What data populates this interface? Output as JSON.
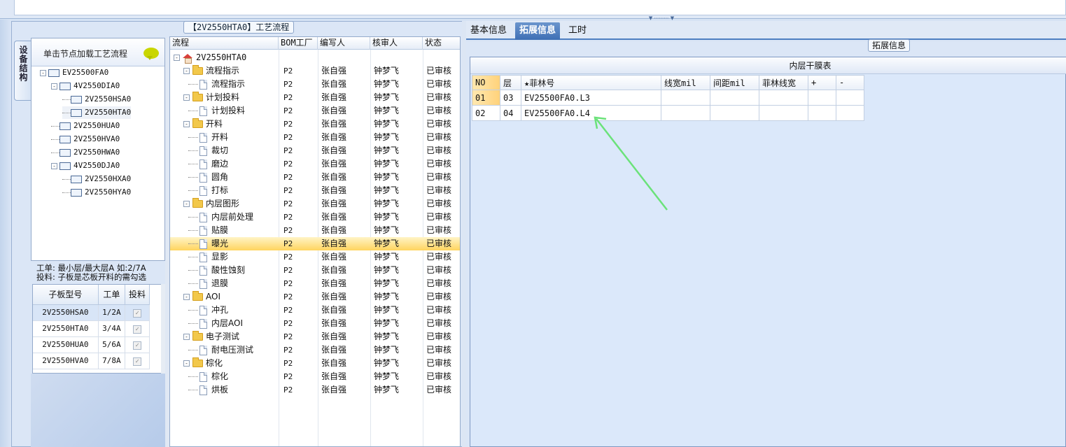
{
  "left": {
    "panel_title": "【2V2550HTA0】工艺流程",
    "vertical_tab": "设备结构",
    "tree_header": "单击节点加载工艺流程",
    "tree": [
      {
        "label": "EV25500FA0",
        "level": 0,
        "expander": "-"
      },
      {
        "label": "4V2550DIA0",
        "level": 1,
        "expander": "-"
      },
      {
        "label": "2V2550HSA0",
        "level": 2,
        "expander": ""
      },
      {
        "label": "2V2550HTA0",
        "level": 2,
        "expander": "",
        "selected": true
      },
      {
        "label": "2V2550HUA0",
        "level": 1,
        "expander": ""
      },
      {
        "label": "2V2550HVA0",
        "level": 1,
        "expander": ""
      },
      {
        "label": "2V2550HWA0",
        "level": 1,
        "expander": ""
      },
      {
        "label": "4V2550DJA0",
        "level": 1,
        "expander": "-"
      },
      {
        "label": "2V2550HXA0",
        "level": 2,
        "expander": ""
      },
      {
        "label": "2V2550HYA0",
        "level": 2,
        "expander": ""
      }
    ],
    "note_line1": "工单: 最小层/最大层A 如:2/7A",
    "note_line2": "投料: 子板是芯板开料的需勾选",
    "sub_grid": {
      "headers": [
        "子板型号",
        "工单",
        "投料"
      ],
      "rows": [
        {
          "model": "2V2550HSA0",
          "order": "1/2A",
          "checked": true
        },
        {
          "model": "2V2550HTA0",
          "order": "3/4A",
          "checked": true
        },
        {
          "model": "2V2550HUA0",
          "order": "5/6A",
          "checked": true
        },
        {
          "model": "2V2550HVA0",
          "order": "7/8A",
          "checked": true
        }
      ],
      "check_mark": "✓"
    }
  },
  "flow": {
    "headers": [
      "流程",
      "BOM工厂",
      "编写人",
      "核审人",
      "状态"
    ],
    "rows": [
      {
        "name": "2V2550HTA0",
        "type": "root",
        "expander": "-",
        "factory": "",
        "writer": "",
        "reviewer": "",
        "status": ""
      },
      {
        "name": "流程指示",
        "type": "folder",
        "expander": "-",
        "factory": "P2",
        "writer": "张自强",
        "reviewer": "钟梦飞",
        "status": "已审核"
      },
      {
        "name": "流程指示",
        "type": "doc",
        "factory": "P2",
        "writer": "张自强",
        "reviewer": "钟梦飞",
        "status": "已审核"
      },
      {
        "name": "计划投料",
        "type": "folder",
        "expander": "-",
        "factory": "P2",
        "writer": "张自强",
        "reviewer": "钟梦飞",
        "status": "已审核"
      },
      {
        "name": "计划投料",
        "type": "doc",
        "factory": "P2",
        "writer": "张自强",
        "reviewer": "钟梦飞",
        "status": "已审核"
      },
      {
        "name": "开料",
        "type": "folder",
        "expander": "-",
        "factory": "P2",
        "writer": "张自强",
        "reviewer": "钟梦飞",
        "status": "已审核"
      },
      {
        "name": "开料",
        "type": "doc",
        "factory": "P2",
        "writer": "张自强",
        "reviewer": "钟梦飞",
        "status": "已审核"
      },
      {
        "name": "裁切",
        "type": "doc",
        "factory": "P2",
        "writer": "张自强",
        "reviewer": "钟梦飞",
        "status": "已审核"
      },
      {
        "name": "磨边",
        "type": "doc",
        "factory": "P2",
        "writer": "张自强",
        "reviewer": "钟梦飞",
        "status": "已审核"
      },
      {
        "name": "圆角",
        "type": "doc",
        "factory": "P2",
        "writer": "张自强",
        "reviewer": "钟梦飞",
        "status": "已审核"
      },
      {
        "name": "打标",
        "type": "doc",
        "factory": "P2",
        "writer": "张自强",
        "reviewer": "钟梦飞",
        "status": "已审核"
      },
      {
        "name": "内层图形",
        "type": "folder",
        "expander": "-",
        "factory": "P2",
        "writer": "张自强",
        "reviewer": "钟梦飞",
        "status": "已审核"
      },
      {
        "name": "内层前处理",
        "type": "doc",
        "factory": "P2",
        "writer": "张自强",
        "reviewer": "钟梦飞",
        "status": "已审核"
      },
      {
        "name": "贴膜",
        "type": "doc",
        "factory": "P2",
        "writer": "张自强",
        "reviewer": "钟梦飞",
        "status": "已审核"
      },
      {
        "name": "曝光",
        "type": "doc",
        "factory": "P2",
        "writer": "张自强",
        "reviewer": "钟梦飞",
        "status": "已审核",
        "selected": true
      },
      {
        "name": "显影",
        "type": "doc",
        "factory": "P2",
        "writer": "张自强",
        "reviewer": "钟梦飞",
        "status": "已审核"
      },
      {
        "name": "酸性蚀刻",
        "type": "doc",
        "factory": "P2",
        "writer": "张自强",
        "reviewer": "钟梦飞",
        "status": "已审核"
      },
      {
        "name": "退膜",
        "type": "doc",
        "factory": "P2",
        "writer": "张自强",
        "reviewer": "钟梦飞",
        "status": "已审核"
      },
      {
        "name": "AOI",
        "type": "folder",
        "expander": "-",
        "factory": "P2",
        "writer": "张自强",
        "reviewer": "钟梦飞",
        "status": "已审核"
      },
      {
        "name": "冲孔",
        "type": "doc",
        "factory": "P2",
        "writer": "张自强",
        "reviewer": "钟梦飞",
        "status": "已审核"
      },
      {
        "name": "内层AOI",
        "type": "doc",
        "factory": "P2",
        "writer": "张自强",
        "reviewer": "钟梦飞",
        "status": "已审核"
      },
      {
        "name": "电子测试",
        "type": "folder",
        "expander": "-",
        "factory": "P2",
        "writer": "张自强",
        "reviewer": "钟梦飞",
        "status": "已审核"
      },
      {
        "name": "耐电压测试",
        "type": "doc",
        "factory": "P2",
        "writer": "张自强",
        "reviewer": "钟梦飞",
        "status": "已审核"
      },
      {
        "name": "棕化",
        "type": "folder",
        "expander": "-",
        "factory": "P2",
        "writer": "张自强",
        "reviewer": "钟梦飞",
        "status": "已审核"
      },
      {
        "name": "棕化",
        "type": "doc",
        "factory": "P2",
        "writer": "张自强",
        "reviewer": "钟梦飞",
        "status": "已审核"
      },
      {
        "name": "烘板",
        "type": "doc",
        "factory": "P2",
        "writer": "张自强",
        "reviewer": "钟梦飞",
        "status": "已审核"
      }
    ]
  },
  "right": {
    "tabs": [
      {
        "label": "基本信息",
        "active": false
      },
      {
        "label": "拓展信息",
        "active": true
      },
      {
        "label": "工时",
        "active": false
      }
    ],
    "group_title": "拓展信息",
    "table_title": "内层干膜表",
    "table": {
      "headers": [
        "NO",
        "层",
        "★菲林号",
        "线宽mil",
        "间距mil",
        "菲林线宽",
        "+",
        "-"
      ],
      "rows": [
        [
          "01",
          "03",
          "EV25500FA0.L3",
          "",
          "",
          "",
          "",
          ""
        ],
        [
          "02",
          "04",
          "EV25500FA0.L4",
          "",
          "",
          "",
          "",
          ""
        ]
      ]
    },
    "annotation_arrow_color": "#6be27a"
  },
  "colors": {
    "selection_gold": "#ffd45e",
    "tab_active": "#3e6fb5",
    "panel_bg": "#dbe6f6"
  }
}
